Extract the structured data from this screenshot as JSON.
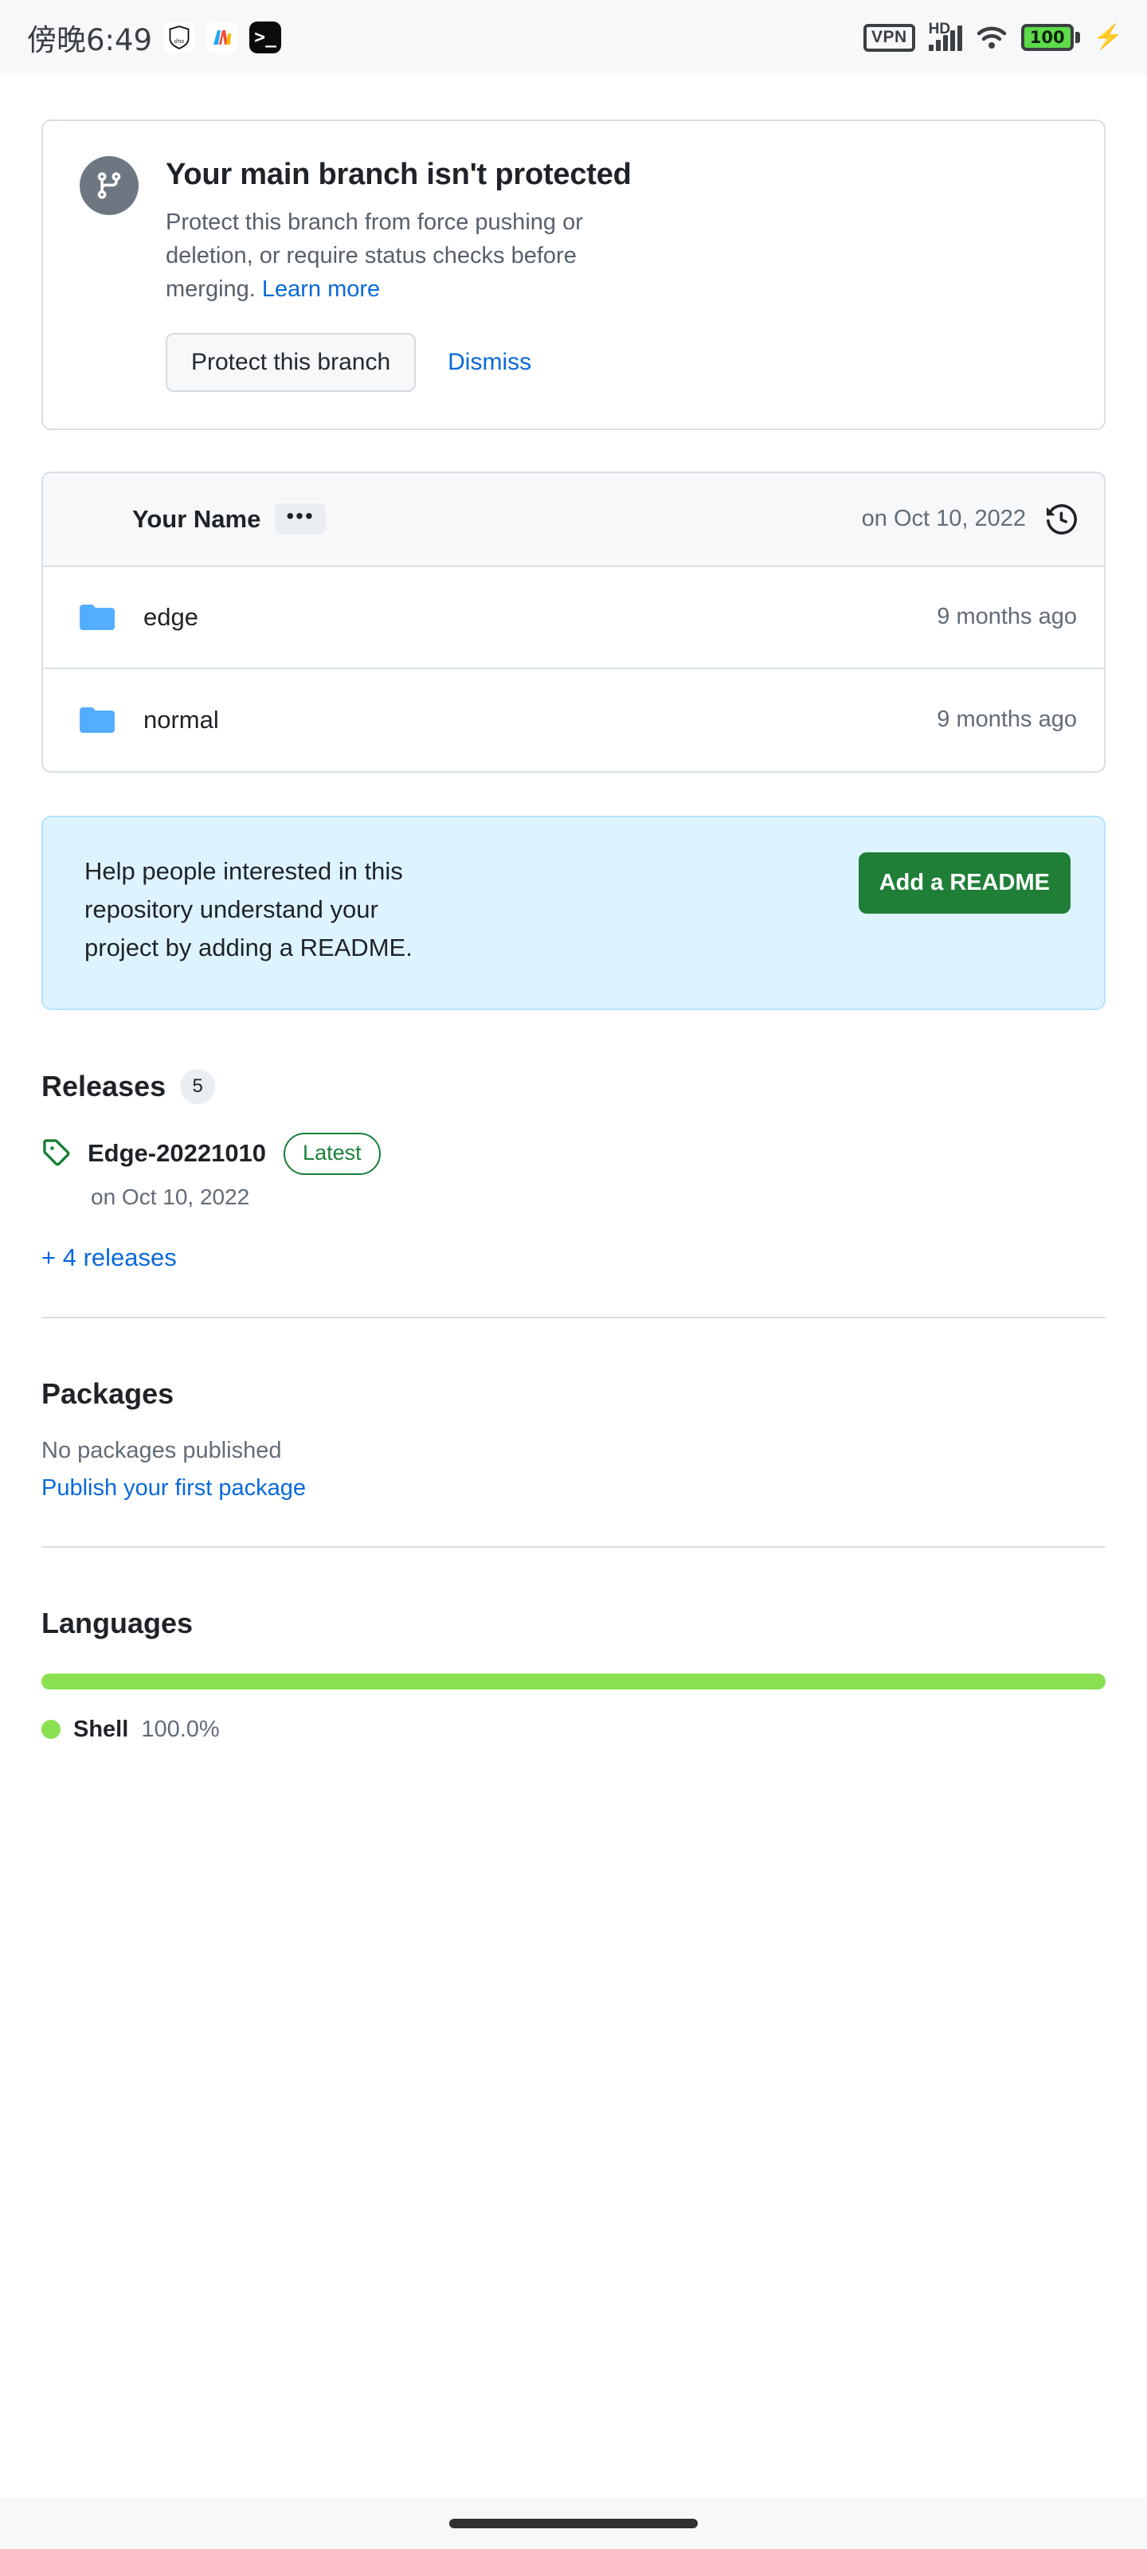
{
  "status_bar": {
    "time": "傍晚6:49",
    "app_icons": [
      "dns-shield-icon",
      "mi-browser-icon",
      "terminal-icon"
    ],
    "vpn_label": "VPN",
    "network_label": "HD",
    "battery_level": "100",
    "battery_color": "#5ddb4a",
    "icons": [
      "vpn-icon",
      "signal-icon",
      "wifi-icon",
      "battery-icon",
      "charging-bolt-icon"
    ]
  },
  "branch_banner": {
    "icon": "git-branch-icon",
    "title": "Your main branch isn't protected",
    "description": "Protect this branch from force pushing or deletion, or require status checks before merging.",
    "learn_more": "Learn more",
    "primary_button": "Protect this branch",
    "dismiss_button": "Dismiss"
  },
  "files": {
    "commit": {
      "author": "Your Name",
      "dots": "•••",
      "date": "on Oct 10, 2022",
      "history_icon": "history-icon"
    },
    "rows": [
      {
        "icon": "folder-icon",
        "name": "edge",
        "age": "9 months ago"
      },
      {
        "icon": "folder-icon",
        "name": "normal",
        "age": "9 months ago"
      }
    ]
  },
  "readme_panel": {
    "text": "Help people interested in this repository understand your project by adding a README.",
    "button": "Add a README",
    "button_color": "#1f7f37",
    "background_color": "#ddf4ff"
  },
  "releases": {
    "title": "Releases",
    "count": "5",
    "tag_icon": "tag-icon",
    "latest_name": "Edge-20221010",
    "latest_badge": "Latest",
    "latest_date": "on Oct 10, 2022",
    "more_link": "+ 4 releases"
  },
  "packages": {
    "title": "Packages",
    "empty_text": "No packages published",
    "publish_link": "Publish your first package"
  },
  "languages": {
    "title": "Languages",
    "items": [
      {
        "name": "Shell",
        "percent": "100.0%",
        "color": "#89e051",
        "width": "100%"
      }
    ]
  },
  "nav_bar": {
    "handle": "home-indicator"
  }
}
